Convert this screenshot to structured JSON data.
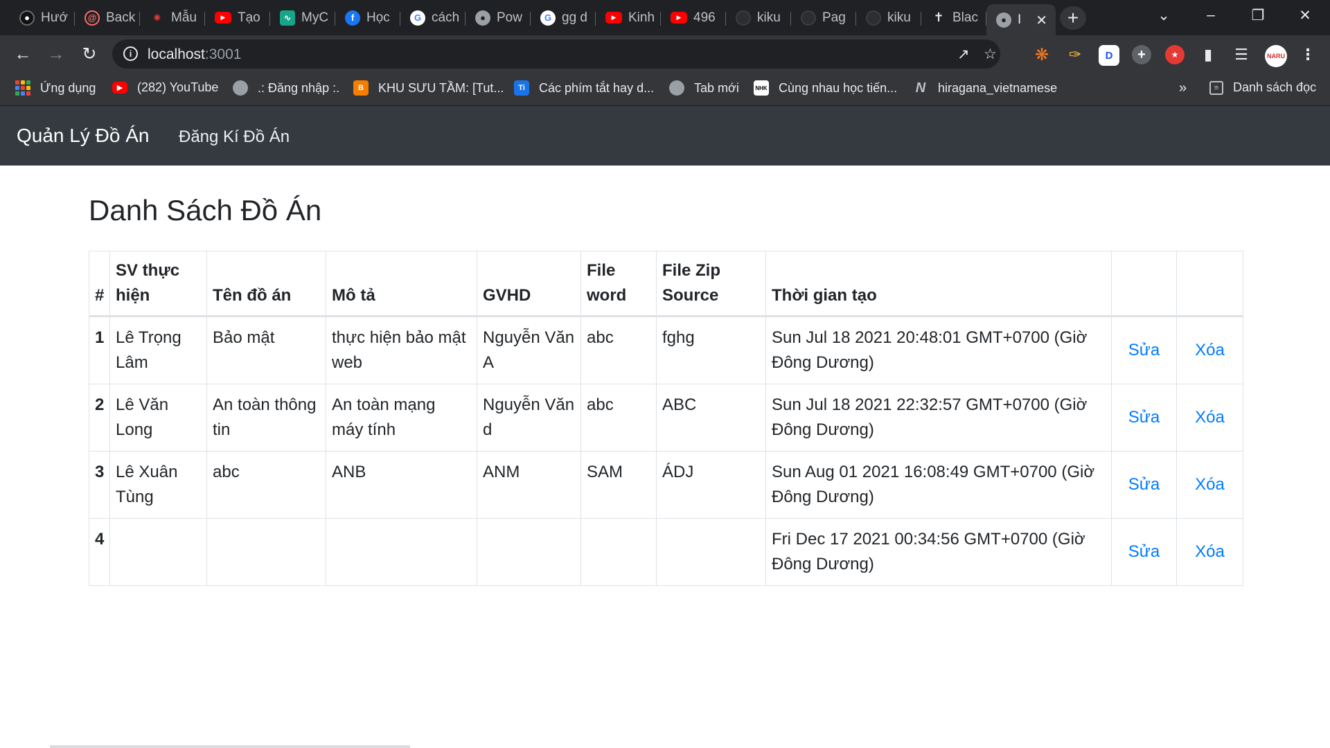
{
  "browser": {
    "tabs": [
      {
        "label": "Hướ",
        "icon": "user-icon"
      },
      {
        "label": "Back",
        "icon": "spiral-icon"
      },
      {
        "label": "Mẫu",
        "icon": "logo-icon"
      },
      {
        "label": "Tạo",
        "icon": "youtube-icon"
      },
      {
        "label": "MyC",
        "icon": "chart-icon"
      },
      {
        "label": "Học",
        "icon": "facebook-icon"
      },
      {
        "label": "cách",
        "icon": "google-icon"
      },
      {
        "label": "Pow",
        "icon": "globe-icon"
      },
      {
        "label": "gg d",
        "icon": "google-icon"
      },
      {
        "label": "Kinh",
        "icon": "youtube-icon"
      },
      {
        "label": "496",
        "icon": "youtube-icon"
      },
      {
        "label": "kiku",
        "icon": "github-icon"
      },
      {
        "label": "Pag",
        "icon": "github-icon"
      },
      {
        "label": "kiku",
        "icon": "github-icon"
      },
      {
        "label": "Blac",
        "icon": "pin-icon"
      },
      {
        "label": "I",
        "icon": "globe-icon",
        "active": true
      }
    ],
    "address": {
      "host": "localhost",
      "port": ":3001"
    },
    "bookmarks": [
      {
        "label": "Ứng dụng",
        "icon": "apps-grid-icon"
      },
      {
        "label": "(282) YouTube",
        "icon": "youtube-icon"
      },
      {
        "label": ".: Đăng nhập :.",
        "icon": "globe-icon"
      },
      {
        "label": "KHU SƯU TẦM: [Tut...",
        "icon": "blogger-icon"
      },
      {
        "label": "Các phím tắt hay d...",
        "icon": "doc-icon"
      },
      {
        "label": "Tab mới",
        "icon": "circle-icon"
      },
      {
        "label": "Cùng nhau học tiến...",
        "icon": "nhk-icon"
      },
      {
        "label": "hiragana_vietnamese",
        "icon": "notion-icon"
      }
    ],
    "overflow_label": "»",
    "reading_list_label": "Danh sách đọc"
  },
  "nav": {
    "brand": "Quản Lý Đồ Án",
    "link": "Đăng Kí Đồ Án"
  },
  "page": {
    "title": "Danh Sách Đồ Án"
  },
  "table": {
    "headers": [
      "#",
      "SV thực hiện",
      "Tên đồ án",
      "Mô tả",
      "GVHD",
      "File word",
      "File Zip Source",
      "Thời gian tạo",
      "",
      ""
    ],
    "rows": [
      {
        "num": "1",
        "student": "Lê Trọng Lâm",
        "name": "Bảo mật",
        "desc": "thực hiện bảo mật web",
        "advisor": "Nguyễn Văn A",
        "word": "abc",
        "zip": "fghg",
        "created": "Sun Jul 18 2021 20:48:01 GMT+0700 (Giờ Đông Dương)",
        "edit": "Sửa",
        "delete": "Xóa"
      },
      {
        "num": "2",
        "student": "Lê Văn Long",
        "name": "An toàn thông tin",
        "desc": "An toàn mạng máy tính",
        "advisor": "Nguyễn Văn d",
        "word": "abc",
        "zip": "ABC",
        "created": "Sun Jul 18 2021 22:32:57 GMT+0700 (Giờ Đông Dương)",
        "edit": "Sửa",
        "delete": "Xóa"
      },
      {
        "num": "3",
        "student": "Lê Xuân Tùng",
        "name": "abc",
        "desc": "ANB",
        "advisor": "ANM",
        "word": "SAM",
        "zip": "ÁDJ",
        "created": "Sun Aug 01 2021 16:08:49 GMT+0700 (Giờ Đông Dương)",
        "edit": "Sửa",
        "delete": "Xóa"
      },
      {
        "num": "4",
        "student": "",
        "name": "",
        "desc": "",
        "advisor": "",
        "word": "",
        "zip": "",
        "created": "Fri Dec 17 2021 00:34:56 GMT+0700 (Giờ Đông Dương)",
        "edit": "Sửa",
        "delete": "Xóa"
      }
    ]
  },
  "colors": {
    "navbar": "#343a40",
    "link": "#007bff",
    "chrome_dark": "#202124",
    "chrome_toolbar": "#35363a"
  }
}
